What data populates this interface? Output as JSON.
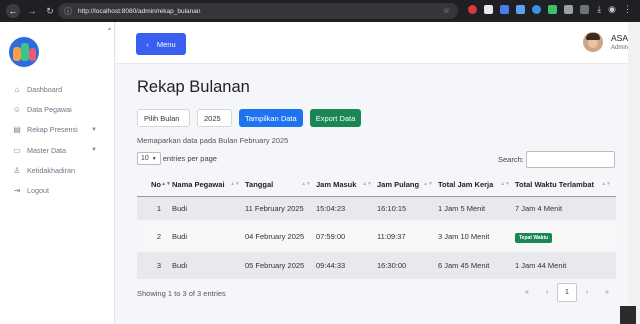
{
  "browser": {
    "url": "http://localhost:8080/admin/rekap_bulanan"
  },
  "sidebar": {
    "items": [
      {
        "label": "Dashboard",
        "icon": "home-icon"
      },
      {
        "label": "Data Pegawai",
        "icon": "users-icon"
      },
      {
        "label": "Rekap Presensi",
        "icon": "document-icon"
      },
      {
        "label": "Master Data",
        "icon": "database-icon"
      },
      {
        "label": "Ketidakhadiran",
        "icon": "user-x-icon"
      },
      {
        "label": "Logout",
        "icon": "logout-icon"
      }
    ]
  },
  "header": {
    "menu_label": "Menu",
    "user_name": "ASA",
    "user_role": "Admin"
  },
  "page": {
    "title": "Rekap Bulanan",
    "month_select": "Pilih Bulan",
    "year_value": "2025",
    "show_button": "Tampilkan Data",
    "export_button": "Export Data",
    "description": "Memaparkan data pada Bulan February 2025",
    "entries_value": "10",
    "entries_label": "entries per page",
    "search_label": "Search:",
    "showing": "Showing 1 to 3 of 3 entries",
    "current_page": "1"
  },
  "table": {
    "headers": [
      "No",
      "Nama Pegawai",
      "Tanggal",
      "Jam Masuk",
      "Jam Pulang",
      "Total Jam Kerja",
      "Total Waktu Terlambat"
    ],
    "rows": [
      {
        "no": "1",
        "nama": "Budi",
        "tanggal": "11 February 2025",
        "masuk": "15:04:23",
        "pulang": "16:10:15",
        "kerja": "1 Jam 5 Menit",
        "terlambat": "7 Jam 4 Menit",
        "badge": false
      },
      {
        "no": "2",
        "nama": "Budi",
        "tanggal": "04 February 2025",
        "masuk": "07:59:00",
        "pulang": "11:09:37",
        "kerja": "3 Jam 10 Menit",
        "terlambat": "Tepat Waktu",
        "badge": true
      },
      {
        "no": "3",
        "nama": "Budi",
        "tanggal": "05 February 2025",
        "masuk": "09:44:33",
        "pulang": "16:30:00",
        "kerja": "6 Jam 45 Menit",
        "terlambat": "1 Jam 44 Menit",
        "badge": false
      }
    ]
  },
  "colors": {
    "primary": "#3a5ff0",
    "blue_button": "#1e73f0",
    "success": "#198754"
  }
}
